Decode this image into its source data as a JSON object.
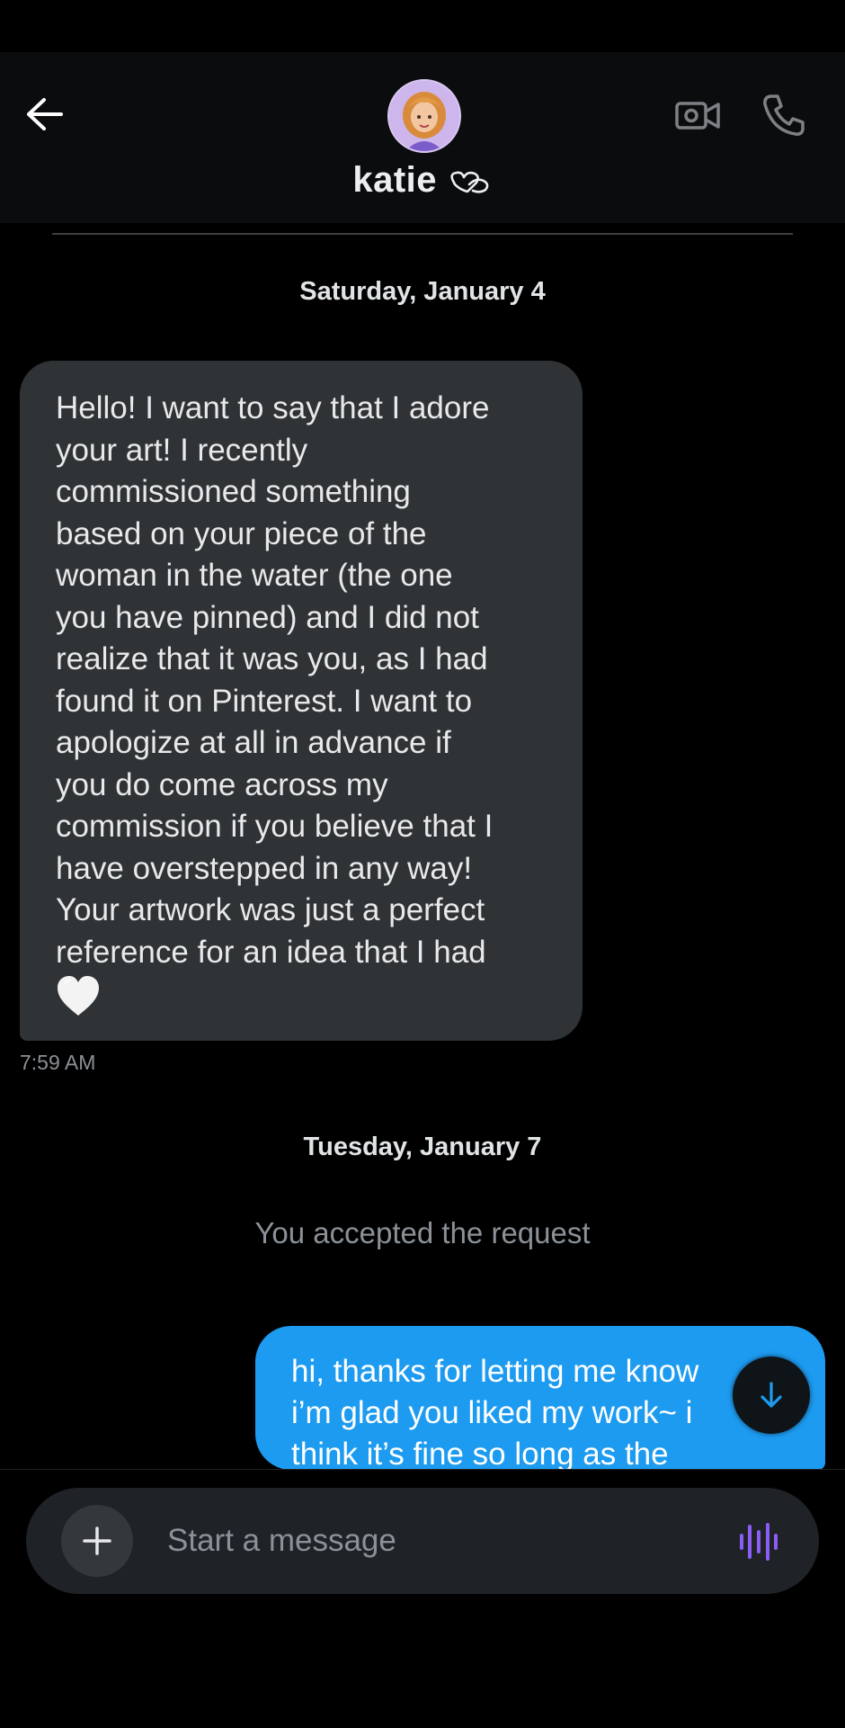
{
  "header": {
    "contact_name": "katie ",
    "contact_symbol": "🫶",
    "back_icon": "arrow-left-icon",
    "video_icon": "video-camera-icon",
    "phone_icon": "phone-icon"
  },
  "conversation": {
    "date_1": "Saturday, January 4",
    "incoming_message": {
      "lines": [
        "Hello! I want to say that I adore",
        "your art! I recently",
        "commissioned something",
        "based on your piece of the",
        "woman in the water (the one",
        "you have pinned) and I did not",
        "realize that it was you, as I had",
        "found it on Pinterest. I want to",
        "apologize at all in advance if",
        "you do come across my",
        "commission if you believe that I",
        "have overstepped in any way!",
        "Your artwork was just a perfect",
        "reference for an idea that I had"
      ],
      "emoji": "white-heart-icon",
      "time": "7:59 AM"
    },
    "date_2": "Tuesday, January 7",
    "system_message": "You accepted the request",
    "outgoing_message": {
      "lines": [
        "hi, thanks for letting me know",
        "i’m glad you liked my work~ i",
        "think it’s fine so long as the"
      ]
    }
  },
  "composer": {
    "placeholder": "Start a message",
    "value": "",
    "add_icon": "plus-icon",
    "voice_icon": "voice-waveform-icon"
  },
  "colors": {
    "background": "#000000",
    "incoming_bubble": "#2f3336",
    "outgoing_bubble": "#1d9bf0",
    "accent_voice": "#8b5cf6"
  }
}
